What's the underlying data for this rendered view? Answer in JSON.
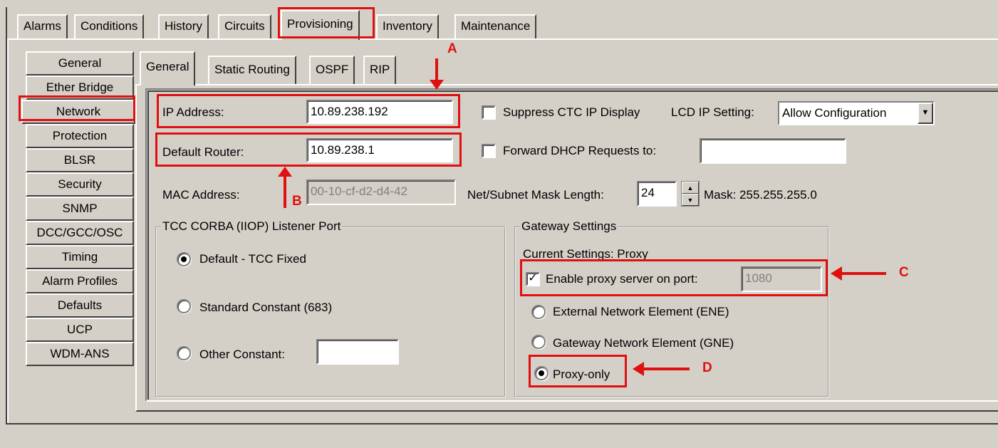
{
  "top_tabs": [
    "Alarms",
    "Conditions",
    "History",
    "Circuits",
    "Provisioning",
    "Inventory",
    "Maintenance"
  ],
  "side_nav": [
    "General",
    "Ether Bridge",
    "Network",
    "Protection",
    "BLSR",
    "Security",
    "SNMP",
    "DCC/GCC/OSC",
    "Timing",
    "Alarm Profiles",
    "Defaults",
    "UCP",
    "WDM-ANS"
  ],
  "inner_tabs": [
    "General",
    "Static Routing",
    "OSPF",
    "RIP"
  ],
  "form": {
    "ip_label": "IP Address:",
    "ip_value": "10.89.238.192",
    "router_label": "Default Router:",
    "router_value": "10.89.238.1",
    "mac_label": "MAC Address:",
    "mac_value": "00-10-cf-d2-d4-42",
    "suppress_label": "Suppress CTC IP Display",
    "lcd_label": "LCD IP Setting:",
    "lcd_value": "Allow Configuration",
    "dhcp_label": "Forward DHCP Requests to:",
    "dhcp_value": "",
    "mask_len_label": "Net/Subnet Mask Length:",
    "mask_len_value": "24",
    "mask_label": "Mask: 255.255.255.0"
  },
  "corba": {
    "title": "TCC CORBA (IIOP) Listener Port",
    "opt1": "Default - TCC Fixed",
    "opt2": "Standard Constant (683)",
    "opt3": "Other Constant:",
    "other_value": ""
  },
  "gateway": {
    "title": "Gateway Settings",
    "current": "Current Settings: Proxy",
    "enable_label": "Enable proxy server on port:",
    "port_value": "1080",
    "ene": "External Network Element (ENE)",
    "gne": "Gateway Network Element (GNE)",
    "proxy": "Proxy-only"
  },
  "callouts": {
    "a": "A",
    "b": "B",
    "c": "C",
    "d": "D"
  },
  "colors": {
    "bg": "#d4d0c8",
    "annotation": "#e01010"
  }
}
